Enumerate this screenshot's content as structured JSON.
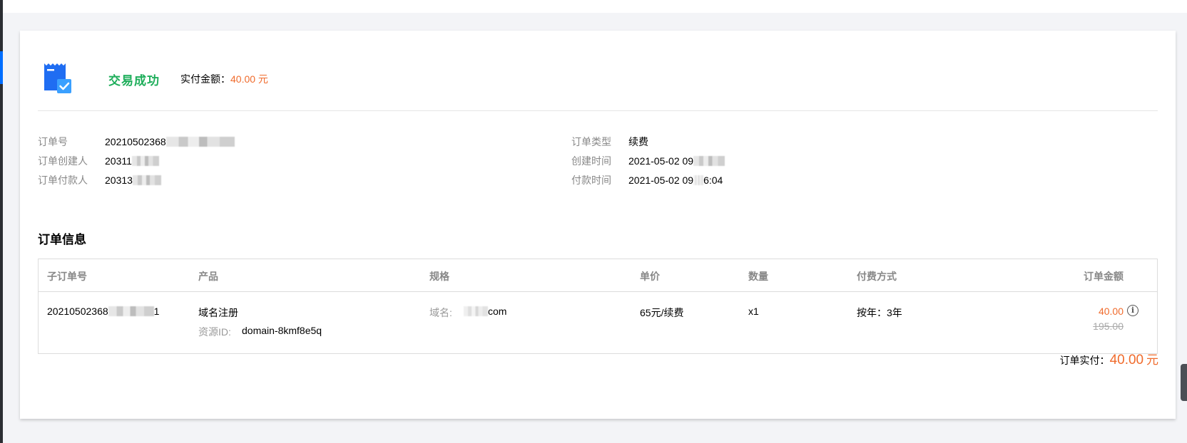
{
  "status": {
    "title": "交易成功",
    "paid_label": "实付金额：",
    "paid_value": "40.00 元"
  },
  "order_meta": {
    "left": [
      {
        "label": "订单号",
        "value": "20210502368"
      },
      {
        "label": "订单创建人",
        "value": "20311"
      },
      {
        "label": "订单付款人",
        "value": "20313"
      }
    ],
    "right": [
      {
        "label": "订单类型",
        "value": "续费"
      },
      {
        "label": "创建时间",
        "value": "2021-05-02 09"
      },
      {
        "label": "付款时间",
        "value": "2021-05-02 09",
        "value_suffix": "6:04"
      }
    ]
  },
  "section_title": "订单信息",
  "table": {
    "headers": [
      "子订单号",
      "产品",
      "规格",
      "单价",
      "数量",
      "付费方式",
      "订单金额"
    ],
    "row": {
      "sub_order_no": "20210502368",
      "sub_order_suffix": "1",
      "product": "域名注册",
      "resource_label": "资源ID:",
      "resource_id": "domain-8kmf8e5q",
      "spec_label": "域名:",
      "spec_value": "com",
      "unit_price": "65元/续费",
      "quantity": "x1",
      "pay_method": "按年：3年",
      "amount": "40.00",
      "original_amount": "195.00"
    }
  },
  "total": {
    "label": "订单实付：",
    "amount": "40.00",
    "unit": "元"
  },
  "colors": {
    "success": "#1fae5b",
    "price": "#f06b2c",
    "accent": "#006eff"
  }
}
